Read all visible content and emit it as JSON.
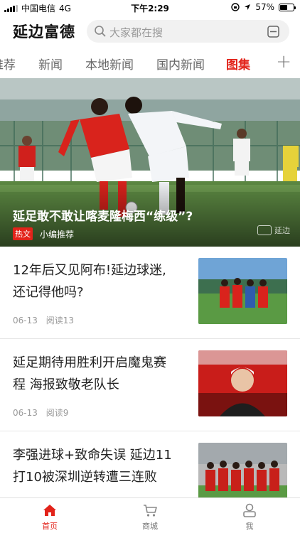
{
  "status_bar": {
    "carrier": "中国电信",
    "network": "4G",
    "time": "下午2:29",
    "battery": "57%",
    "battery_level": 0.57
  },
  "header": {
    "brand": "延边富德",
    "search_placeholder": "大家都在搜",
    "icons": [
      "search-icon",
      "scan-icon"
    ]
  },
  "tabs": [
    {
      "label": "推荐",
      "active": false
    },
    {
      "label": "新闻",
      "active": false
    },
    {
      "label": "本地新闻",
      "active": false
    },
    {
      "label": "国内新闻",
      "active": false
    },
    {
      "label": "图集",
      "active": true
    }
  ],
  "add_tab_label": "+",
  "hero": {
    "title": "延足敢不敢让喀麦隆梅西“练级”?",
    "tag": "热文",
    "source": "小编推荐",
    "watermark": "延边",
    "accent": "#e2231a"
  },
  "articles": [
    {
      "title": "12年后又见阿布!延边球迷,还记得他吗?",
      "date": "06-13",
      "reads": "阅读13"
    },
    {
      "title": "延足期待用胜利开启魔鬼赛程 海报致敬老队长",
      "date": "06-13",
      "reads": "阅读9"
    },
    {
      "title": "李强进球+致命失误 延边11打10被深圳逆转遭三连败",
      "date": "",
      "reads": ""
    }
  ],
  "bottom_nav": [
    {
      "label": "首页",
      "icon": "home-icon",
      "active": true
    },
    {
      "label": "商城",
      "icon": "cart-icon",
      "active": false
    },
    {
      "label": "我",
      "icon": "user-icon",
      "active": false
    }
  ]
}
